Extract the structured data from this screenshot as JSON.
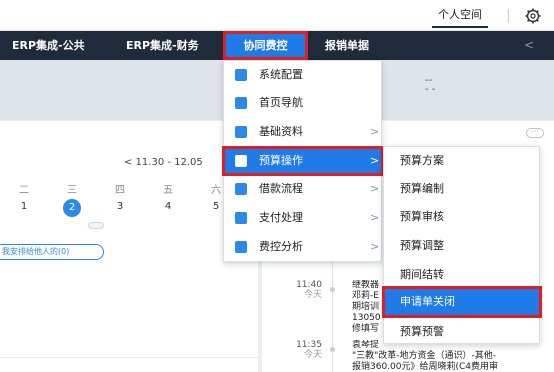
{
  "header": {
    "user_menu": "个人空间",
    "settings_icon": "gear-icon"
  },
  "nav": {
    "items": [
      {
        "label": "ERP集成-公共"
      },
      {
        "label": "ERP集成-财务"
      },
      {
        "label": "协同费控",
        "active": true
      },
      {
        "label": "报销单据"
      }
    ],
    "scroll_icon": "chevron-left-icon"
  },
  "dropdown": {
    "items": [
      {
        "label": "系统配置",
        "icon": "settings-panel-icon",
        "color": "#2b8ae8"
      },
      {
        "label": "首页导航",
        "icon": "home-nav-icon",
        "color": "#2b8ae8"
      },
      {
        "label": "基础资料",
        "icon": "database-icon",
        "color": "#2b8ae8",
        "has_submenu": true
      },
      {
        "label": "预算操作",
        "icon": "budget-icon",
        "color": "#ffffff",
        "has_submenu": true,
        "active": true
      },
      {
        "label": "借款流程",
        "icon": "loan-icon",
        "color": "#2b8ae8",
        "has_submenu": true
      },
      {
        "label": "支付处理",
        "icon": "payment-icon",
        "color": "#2b8ae8",
        "has_submenu": true
      },
      {
        "label": "费控分析",
        "icon": "analysis-icon",
        "color": "#2b8ae8",
        "has_submenu": true
      }
    ]
  },
  "submenu": {
    "items": [
      {
        "label": "预算方案"
      },
      {
        "label": "预算编制"
      },
      {
        "label": "预算审核"
      },
      {
        "label": "预算调整"
      },
      {
        "label": "期间结转"
      },
      {
        "label": "申请单关闭",
        "active": true
      },
      {
        "label": "预算预警"
      }
    ]
  },
  "band": {
    "dash1": "--",
    "dash2": "- -"
  },
  "calendar": {
    "range": "<  11.30 - 12.05",
    "weekdays": [
      "二",
      "三",
      "四",
      "五",
      "六"
    ],
    "days": [
      "1",
      "2",
      "3",
      "4",
      "5"
    ],
    "today": "2",
    "filter_pill": "我安排给他人的(0)"
  },
  "timeline": {
    "fragment": "1204",
    "entries": [
      {
        "time": "11:40",
        "day": "今天",
        "lines": [
          "继教器",
          "邓莉-E",
          "期培训",
          "13050",
          "修填写"
        ]
      },
      {
        "time": "11:35",
        "day": "今天",
        "lines": [
          "袁琴提",
          "\"三教\"改革-地方资金（通识）-其他-",
          "报销360.00元》给周晓莉(C4费用审"
        ]
      }
    ]
  },
  "colors": {
    "accent": "#1f7be8",
    "highlight": "#e02020",
    "nav_bg": "#1f2b3a"
  }
}
